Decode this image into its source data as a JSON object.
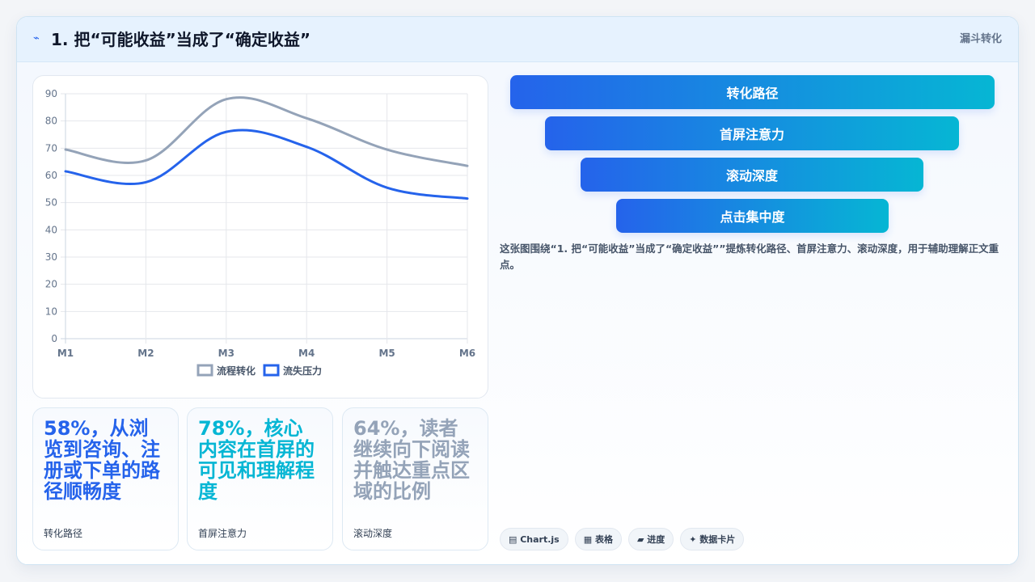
{
  "header": {
    "icon": "⌁",
    "title": "1. 把“可能收益”当成了“确定收益”",
    "tag": "漏斗转化"
  },
  "chart_data": {
    "type": "line",
    "categories": [
      "M1",
      "M2",
      "M3",
      "M4",
      "M5",
      "M6"
    ],
    "ylim": [
      0,
      90
    ],
    "yticks": [
      0,
      10,
      20,
      30,
      40,
      50,
      60,
      70,
      80,
      90
    ],
    "grid": true,
    "legend": "bottom",
    "series": [
      {
        "name": "流程转化",
        "values": [
          69.5,
          65.5,
          88,
          81,
          69.5,
          63.5
        ],
        "color": "#94a3b8"
      },
      {
        "name": "流失压力",
        "values": [
          61.5,
          57.5,
          76,
          70.5,
          55.5,
          51.5
        ],
        "color": "#2563eb"
      }
    ]
  },
  "stats": [
    {
      "value": "58%，从浏览到咨询、注册或下单的路径顺畅度",
      "label": "转化路径",
      "color": "#2563eb"
    },
    {
      "value": "78%，核心内容在首屏的可见和理解程度",
      "label": "首屏注意力",
      "color": "#06b6d4"
    },
    {
      "value": "64%，读者继续向下阅读并触达重点区域的比例",
      "label": "滚动深度",
      "color": "#94a3b8"
    }
  ],
  "funnel": [
    "转化路径",
    "首屏注意力",
    "滚动深度",
    "点击集中度"
  ],
  "description": "这张图围绕“1. 把“可能收益”当成了“确定收益””提炼转化路径、首屏注意力、滚动深度，用于辅助理解正文重点。",
  "chips": [
    "▤ Chart.js",
    "▦ 表格",
    "▰ 进度",
    "✦ 数据卡片"
  ]
}
